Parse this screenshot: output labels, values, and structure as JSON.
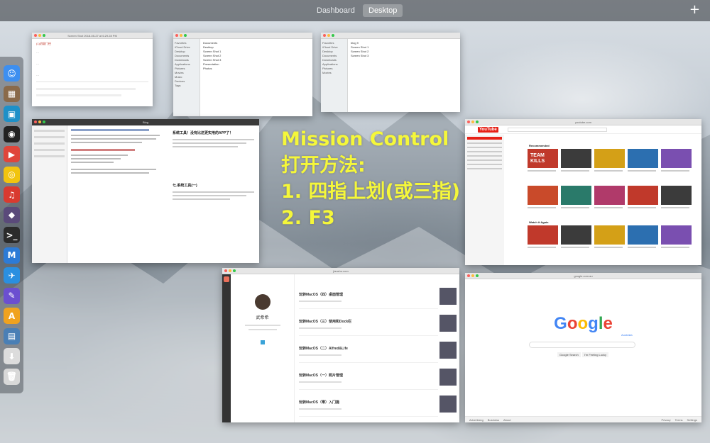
{
  "spaces": {
    "tabs": [
      {
        "label": "Dashboard",
        "active": false
      },
      {
        "label": "Desktop",
        "active": true
      }
    ],
    "add_label": "+"
  },
  "dock": {
    "icons": [
      {
        "name": "finder-icon",
        "color": "#3d8ff0",
        "glyph": "☺"
      },
      {
        "name": "preview-icon",
        "color": "#8a6a4a",
        "glyph": "▦"
      },
      {
        "name": "screen-app-icon",
        "color": "#1e90c8",
        "glyph": "▣"
      },
      {
        "name": "qq-icon",
        "color": "#222222",
        "glyph": "◉"
      },
      {
        "name": "pdf-reader-icon",
        "color": "#e0453a",
        "glyph": "▶"
      },
      {
        "name": "chrome-icon",
        "color": "#f1c40f",
        "glyph": "◎"
      },
      {
        "name": "netease-music-icon",
        "color": "#d93a2f",
        "glyph": "♫"
      },
      {
        "name": "github-icon",
        "color": "#5a4a7a",
        "glyph": "◆"
      },
      {
        "name": "terminal-icon",
        "color": "#2b2b2b",
        "glyph": ">_"
      },
      {
        "name": "markdown-icon",
        "color": "#2d7bd6",
        "glyph": "M"
      },
      {
        "name": "safari-icon",
        "color": "#2a8fe0",
        "glyph": "✈"
      },
      {
        "name": "pencil-app-icon",
        "color": "#6b4fd0",
        "glyph": "✎"
      },
      {
        "name": "app-store-icon",
        "color": "#f0a21f",
        "glyph": "A"
      },
      {
        "name": "photos-icon",
        "color": "#4a7fb5",
        "glyph": "▤"
      },
      {
        "name": "downloads-icon",
        "color": "#dcdcdc",
        "glyph": "⬇"
      },
      {
        "name": "trash-icon",
        "color": "#d8d8d8",
        "glyph": "🗑"
      }
    ]
  },
  "overlay": {
    "line1": "Mission Control",
    "line2": "打开方法:",
    "line3": "1. 四指上划(或三指)",
    "line4": "2. F3"
  },
  "windows": {
    "note": {
      "title": "Screen Shot 2018-05-27 at 6.29.28 PM",
      "lines": [
        "(1)初窥门径",
        "…",
        "…",
        "…"
      ]
    },
    "finder1": {
      "title": "",
      "side": [
        "Favorites",
        "iCloud Drive",
        "Desktop",
        "Documents",
        "Downloads",
        "Applications",
        "Pictures",
        "Movies",
        "Music",
        "Devices",
        "Tags"
      ],
      "items": [
        "Documents",
        "Desktop",
        "Screen Shot 1",
        "Screen Shot 2",
        "Screen Shot 3",
        "Presentation",
        "Photos"
      ]
    },
    "finder2": {
      "title": "",
      "side": [
        "Favorites",
        "iCloud Drive",
        "Desktop",
        "Documents",
        "Downloads",
        "Applications",
        "Pictures",
        "Movies"
      ],
      "items": [
        "blog 9",
        "Screen Shot 1",
        "Screen Shot 2",
        "Screen Shot 3"
      ]
    },
    "editor": {
      "title": "Blog",
      "heading": "系统工具！没有比这更实用的APP了！",
      "section": "七.系统工具(一)",
      "list": [
        "Mission Control",
        "Dashboard",
        "Finder",
        "Spotlight",
        "Launchpad"
      ]
    },
    "youtube": {
      "url": "youtube.com",
      "logo": "YouTube",
      "section1": "Recommended",
      "section2": "Watch it Again",
      "thumb_caption": "TEAM KILLS"
    },
    "blog": {
      "url": "jianshu.com",
      "author": "武希希",
      "posts": [
        "玩转MacOS（四）桌面管理",
        "玩转MacOS（三）使用和Dock栏",
        "玩转MacOS（二）Alfred&Life",
        "玩转MacOS（一）照片管理",
        "玩转MacOS（零）入门篇"
      ]
    },
    "google": {
      "url": "google.com.au",
      "logo_letters": [
        "G",
        "o",
        "o",
        "g",
        "l",
        "e"
      ],
      "logo_colors": [
        "#4285f4",
        "#ea4335",
        "#fbbc05",
        "#4285f4",
        "#34a853",
        "#ea4335"
      ],
      "sub": "Australia",
      "btn_search": "Google Search",
      "btn_lucky": "I'm Feeling Lucky",
      "footer_left": [
        "Advertising",
        "Business",
        "About"
      ],
      "footer_right": [
        "Privacy",
        "Terms",
        "Settings"
      ]
    }
  }
}
